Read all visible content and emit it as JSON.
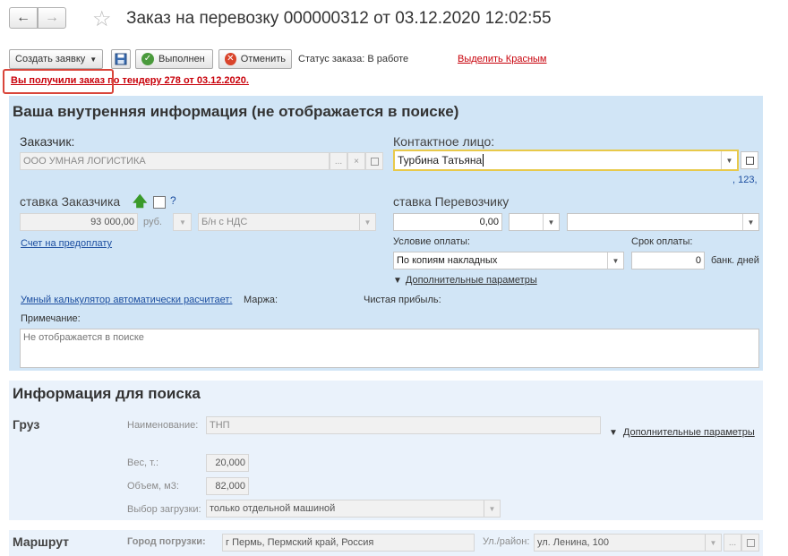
{
  "window": {
    "title": "Заказ на перевозку 000000312 от 03.12.2020 12:02:55"
  },
  "toolbar": {
    "create_label": "Создать заявку",
    "done_label": "Выполнен",
    "cancel_label": "Отменить",
    "status_label": "Статус заказа:",
    "status_value": "В работе",
    "highlight_red_link": "Выделить Красным"
  },
  "notice": {
    "text": "Вы получили заказ по тендеру 278 от 03.12.2020."
  },
  "internal": {
    "title": "Ваша внутренняя информация (не отображается в поиске)",
    "customer_label": "Заказчик:",
    "customer_value": "ООО УМНАЯ ЛОГИСТИКА",
    "contact_label": "Контактное лицо:",
    "contact_value": "Турбина Татьяна",
    "phone_hint": ", 123,",
    "customer_rate_label": "ставка Заказчика",
    "help_mark": "?",
    "customer_rate_value": "93 000,00",
    "currency_value": "руб.",
    "vat_value": "Б/н с НДС",
    "prepay_link": "Счет на предоплату",
    "carrier_rate_label": "ставка Перевозчику",
    "carrier_rate_value": "0,00",
    "payment_cond_label": "Условие оплаты:",
    "payment_cond_value": "По копиям накладных",
    "payment_term_label": "Срок оплаты:",
    "payment_term_value": "0",
    "payment_term_unit": "банк. дней",
    "extra_params_link": "Дополнительные параметры",
    "calc_link": "Умный калькулятор автоматически расчитает:",
    "margin_label": "Маржа:",
    "profit_label": "Чистая прибыль:",
    "note_label": "Примечание:",
    "note_placeholder": "Не отображается в поиске"
  },
  "search_info": {
    "title": "Информация для поиска",
    "cargo_label": "Груз",
    "name_label": "Наименование:",
    "name_value": "ТНП",
    "extra_params_link": "Дополнительные параметры",
    "weight_label": "Вес, т.:",
    "weight_value": "20,000",
    "volume_label": "Объем, м3:",
    "volume_value": "82,000",
    "loading_label": "Выбор загрузки:",
    "loading_value": "только отдельной машиной"
  },
  "route": {
    "title": "Маршрут",
    "city_label": "Город погрузки:",
    "city_value": "г Пермь,  Пермский край, Россия",
    "street_label": "Ул./район:",
    "street_value": "ул. Ленина, 100"
  },
  "colors": {
    "panel_blue": "#d1e5f6",
    "panel_light": "#eaf2fb",
    "link_blue": "#1c4ea0",
    "alert_red": "#c8000a",
    "focus_yellow": "#e8c94a"
  }
}
